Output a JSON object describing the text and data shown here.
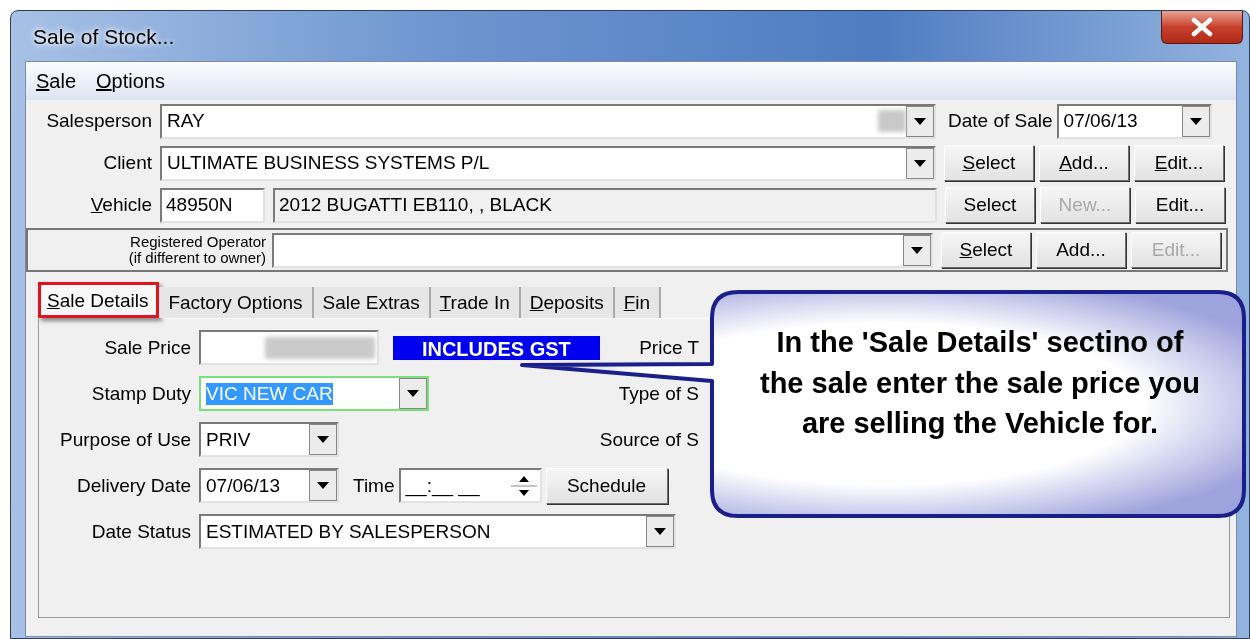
{
  "window": {
    "title": "Sale of Stock..."
  },
  "menu": [
    {
      "label": "Sale",
      "mnemonic": true
    },
    {
      "label": "Options",
      "mnemonic": true
    }
  ],
  "header": {
    "salesperson": {
      "label": "Salesperson",
      "value": "RAY",
      "redacted": true
    },
    "date_of_sale": {
      "label": "Date of Sale",
      "value": "07/06/13"
    },
    "client": {
      "label": "Client",
      "value": "ULTIMATE BUSINESS SYSTEMS P/L",
      "buttons": [
        {
          "label": "Select",
          "mnemonic": true,
          "disabled": false
        },
        {
          "label": "Add...",
          "mnemonic": true,
          "disabled": false
        },
        {
          "label": "Edit...",
          "mnemonic": true,
          "disabled": false
        }
      ]
    },
    "vehicle": {
      "label": "Vehicle",
      "mnemonic": true,
      "stock_number": "48950N",
      "description": "2012 BUGATTI EB110, , BLACK",
      "buttons": [
        {
          "label": "Select",
          "mnemonic": false,
          "disabled": false
        },
        {
          "label": "New...",
          "mnemonic": false,
          "disabled": true
        },
        {
          "label": "Edit...",
          "mnemonic": false,
          "disabled": false
        }
      ]
    },
    "registered_operator": {
      "label": "Registered Operator\n(if different to owner)",
      "buttons": [
        {
          "label": "Select",
          "mnemonic": true,
          "disabled": false
        },
        {
          "label": "Add...",
          "mnemonic": false,
          "disabled": false
        },
        {
          "label": "Edit...",
          "mnemonic": false,
          "disabled": true
        }
      ]
    }
  },
  "tabs": [
    {
      "label": "Sale Details",
      "mnemonic": true,
      "selected": true,
      "annotated": true
    },
    {
      "label": "Factory Options",
      "mnemonic": false,
      "selected": false,
      "annotated": false
    },
    {
      "label": "Sale Extras",
      "mnemonic": false,
      "selected": false,
      "annotated": false
    },
    {
      "label": "Trade In",
      "mnemonic": true,
      "selected": false,
      "annotated": false
    },
    {
      "label": "Deposits",
      "mnemonic": true,
      "selected": false,
      "annotated": false
    },
    {
      "label": "Fin",
      "mnemonic": true,
      "selected": false,
      "annotated": false
    }
  ],
  "sale_details": [
    {
      "kind": "price",
      "label": "Sale Price",
      "redacted": true,
      "badge": "INCLUDES GST",
      "side_label": "Price T"
    },
    {
      "kind": "combo",
      "label": "Stamp Duty",
      "value": "VIC NEW CAR",
      "selected": true,
      "side_label": "Type of S"
    },
    {
      "kind": "short_combo",
      "label": "Purpose of Use",
      "value": "PRIV",
      "selected": false,
      "side_label": "Source of S"
    },
    {
      "kind": "date",
      "label": "Delivery Date",
      "value": "07/06/13",
      "time_label": "Time",
      "time_value": "__:__ __",
      "button": "Schedule"
    },
    {
      "kind": "wide_combo",
      "label": "Date Status",
      "value": "ESTIMATED BY SALESPERSON",
      "selected": false
    }
  ],
  "callout": {
    "text": "In the 'Sale Details' sectino of the sale enter the sale price you are selling the Vehicle for."
  }
}
